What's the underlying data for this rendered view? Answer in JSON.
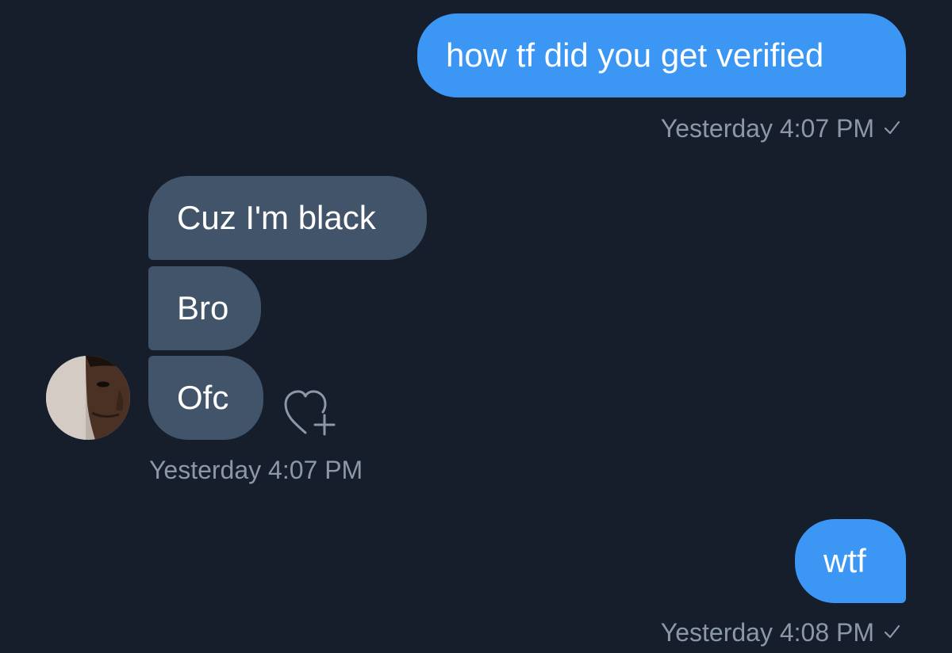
{
  "messages": [
    {
      "id": "m1",
      "direction": "sent",
      "text": "how tf did you get verified"
    },
    {
      "id": "m2",
      "direction": "received",
      "text": "Cuz I'm black"
    },
    {
      "id": "m3",
      "direction": "received",
      "text": "Bro"
    },
    {
      "id": "m4",
      "direction": "received",
      "text": "Ofc"
    },
    {
      "id": "m5",
      "direction": "sent",
      "text": "wtf"
    }
  ],
  "timestamps": {
    "sent_1": "Yesterday 4:07 PM",
    "received_group": "Yesterday 4:07 PM",
    "sent_2": "Yesterday 4:08 PM"
  },
  "icons": {
    "read_receipt": "checkmark-icon",
    "react": "heart-plus-icon",
    "avatar": "user-avatar"
  },
  "colors": {
    "background": "#161e2c",
    "sent_bubble": "#3b97f3",
    "received_bubble": "#42546a",
    "timestamp_text": "#8b98a5"
  }
}
